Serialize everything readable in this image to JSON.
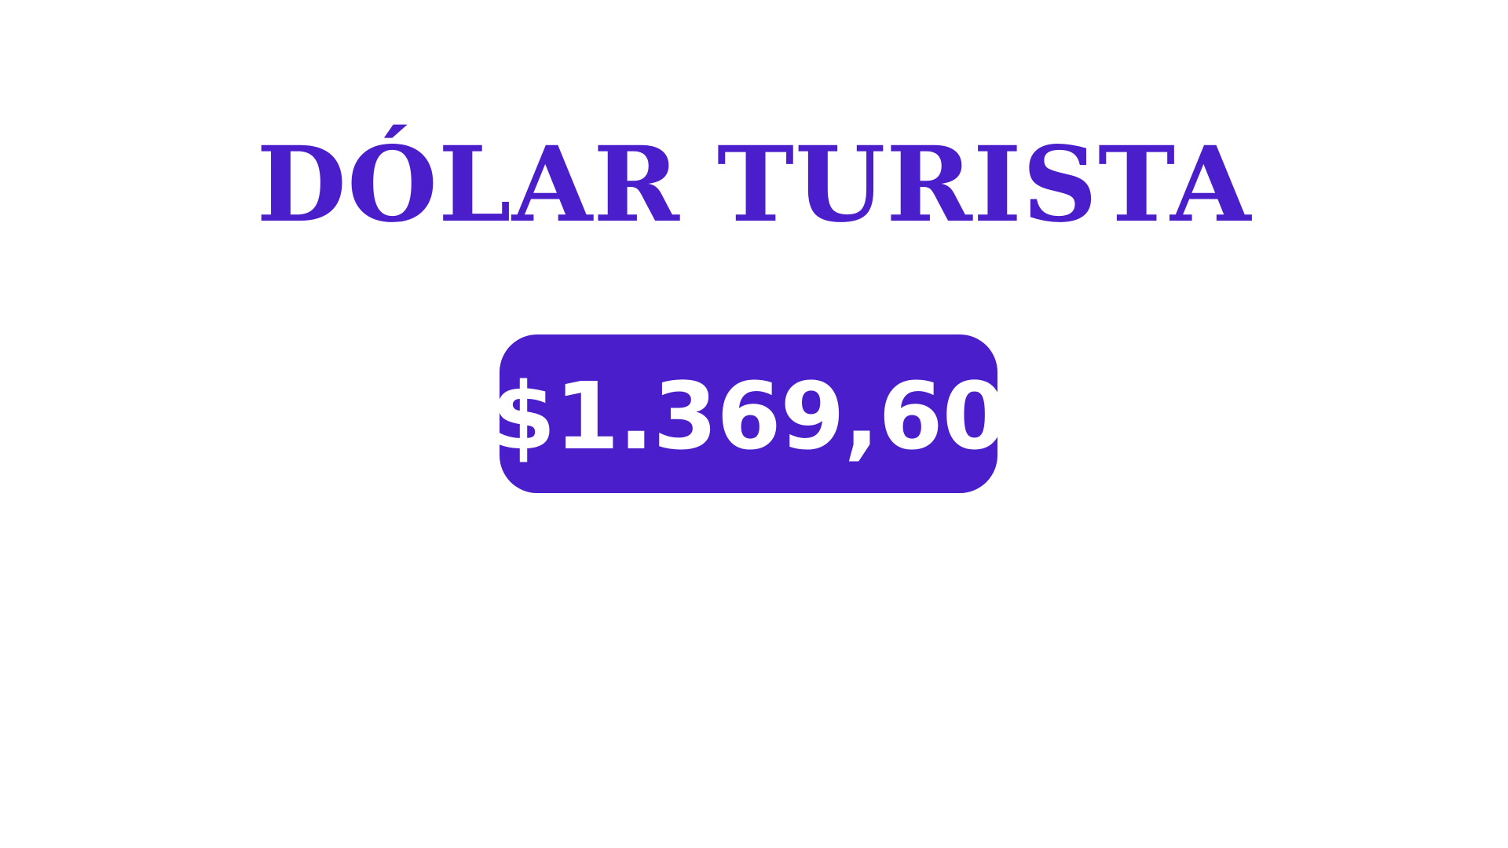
{
  "title": "DÓLAR TURISTA",
  "price": "$1.369,60",
  "colors": {
    "accent": "#4a1fcb",
    "background": "#ffffff",
    "price_text": "#ffffff"
  }
}
